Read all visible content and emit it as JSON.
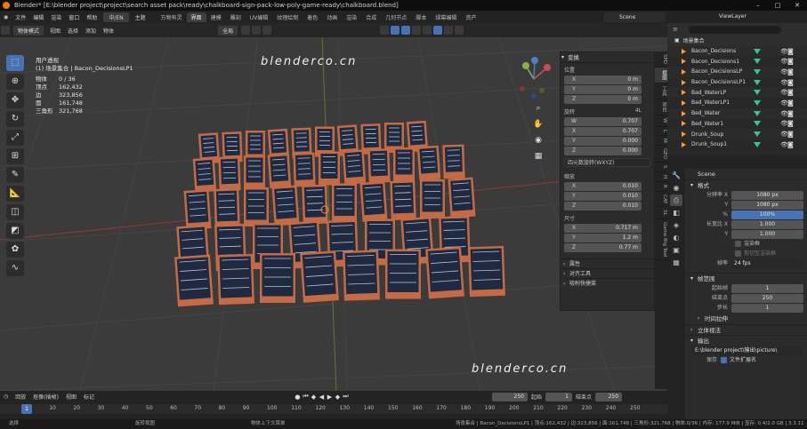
{
  "titlebar": {
    "text": "Blender* [E:\\blender project\\project\\search asset pack\\ready\\chalkboard-sign-pack-low-poly-game-ready\\chalkboard.blend]"
  },
  "menu": {
    "items": [
      "文件",
      "编辑",
      "渲染",
      "窗口",
      "帮助"
    ],
    "lang": "中/EN",
    "theme": "主题"
  },
  "workspaces": [
    "万物有灵",
    "界面",
    "建模",
    "雕刻",
    "UV编辑",
    "纹理绘制",
    "着色",
    "动画",
    "渲染",
    "合成",
    "几何节点",
    "脚本",
    "绿幕编辑",
    "资产"
  ],
  "scene_name": "Scene",
  "view_layer": "ViewLayer",
  "viewport_header": {
    "mode": "物体模式",
    "menus": [
      "视图",
      "选择",
      "添加",
      "物体"
    ],
    "orientation": "全局",
    "options": "选项"
  },
  "stats": {
    "view": "用户透视",
    "collection": "(1) 场景集合 | Bacon_DecisionsLP1",
    "rows": [
      {
        "k": "物体",
        "v": "0 / 36"
      },
      {
        "k": "顶点",
        "v": "162,432"
      },
      {
        "k": "边",
        "v": "323,856"
      },
      {
        "k": "面",
        "v": "161,748"
      },
      {
        "k": "三角形",
        "v": "321,768"
      }
    ]
  },
  "watermarks": {
    "site": "blenderco.cn"
  },
  "npanel": {
    "transform": "变换",
    "location": {
      "label": "位置",
      "x": "0 m",
      "y": "0 m",
      "z": "0 m"
    },
    "rotation": {
      "label": "旋转",
      "w": "0.707",
      "x": "0.707",
      "y": "0.000",
      "z": "0.000",
      "mode": "4L"
    },
    "rotation_mode": "四元数旋转(WXYZ)",
    "scale": {
      "label": "缩放",
      "x": "0.010",
      "y": "0.010",
      "z": "0.010"
    },
    "dimensions": {
      "label": "尺寸",
      "x": "0.717 m",
      "y": "1.2 m",
      "z": "0.77 m"
    },
    "axis": {
      "x": "X",
      "y": "Y",
      "z": "Z",
      "w": "W"
    },
    "sections": [
      "属性",
      "对齐工具",
      "吸附快捷菜"
    ]
  },
  "side_tabs": [
    "Game Rig Tool",
    "SL",
    "CAT",
    "R",
    "H",
    "S",
    "GEO",
    "M",
    "L",
    "W",
    "项目",
    "工具",
    "视图",
    "SPD"
  ],
  "outliner": {
    "header": "场景集合",
    "items": [
      "Bacon_Decisions",
      "Bacon_Decisions1",
      "Bacon_DecisionsLP",
      "Bacon_DecisionsLP1",
      "Bad_WaterLP",
      "Bad_WaterLP1",
      "Bed_Water",
      "Bed_Water1",
      "Drunk_Soup",
      "Drunk_Soup1"
    ]
  },
  "properties": {
    "scene": "Scene",
    "format": {
      "title": "格式",
      "res_x_label": "分辨率 X",
      "res_x": "1080 px",
      "res_y_label": "Y",
      "res_y": "1080 px",
      "pct_label": "%",
      "pct": "100%",
      "aspect_x_label": "长宽比 X",
      "aspect_x": "1.000",
      "aspect_y_label": "Y",
      "aspect_y": "1.000",
      "render_region": "渲染框",
      "crop": "剪切至渲染框",
      "fps_label": "帧率",
      "fps": "24 fps"
    },
    "frame_range": {
      "title": "帧范围",
      "start_label": "起始帧",
      "start": "1",
      "end_label": "结束点",
      "end": "250",
      "step_label": "步长",
      "step": "1"
    },
    "time_stretch": "时间拉伸",
    "stereo": "立体视法",
    "output": {
      "title": "输出",
      "path": "E:\\blender project\\输出\\picture\\",
      "save_label": "保存",
      "ext": "文件扩展名"
    }
  },
  "timeline": {
    "menus": [
      "回放",
      "抠像(插帧)",
      "视图",
      "标记"
    ],
    "current_frame": "250",
    "start_label": "起始",
    "start": "1",
    "end_label": "结束点",
    "end": "250",
    "ruler": [
      "1",
      "10",
      "20",
      "30",
      "40",
      "50",
      "60",
      "70",
      "80",
      "90",
      "100",
      "110",
      "120",
      "130",
      "140",
      "150",
      "160",
      "170",
      "180",
      "190",
      "200",
      "210",
      "220",
      "230",
      "240",
      "250"
    ],
    "frame_marker": "1"
  },
  "status": {
    "left": "选择",
    "mid1": "旋转视图",
    "mid2": "物体上下文菜单",
    "right": "场景集合 | Bacon_DecisionsLP1 | 顶点:162,432 | 边:323,856 | 面:161,748 | 三角形:321,768 | 物体:0/36 | 内存: 177.9 MiB | 显存: 0.4/2.0 GB | 3.3.11"
  },
  "colors": {
    "accent": "#4772b3",
    "orange": "#ff9b2f",
    "board_frame": "#c46a45",
    "board_face": "#1f2a40"
  }
}
